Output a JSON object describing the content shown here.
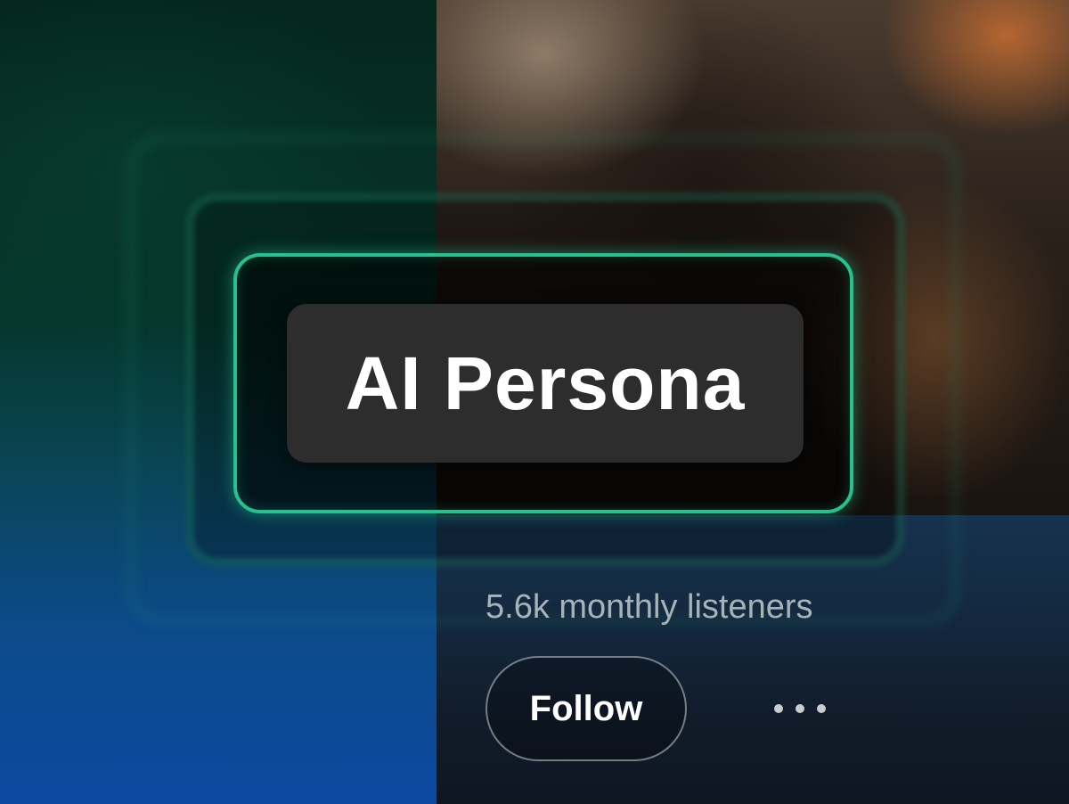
{
  "artist": {
    "name": "AI Persona",
    "listeners": "5.6k monthly listeners"
  },
  "actions": {
    "follow_label": "Follow",
    "more_icon": "ellipsis-horizontal-icon"
  },
  "colors": {
    "accent": "#27c08f",
    "pill_background": "#2d2d2d",
    "listeners_text": "#a6b4b8"
  }
}
